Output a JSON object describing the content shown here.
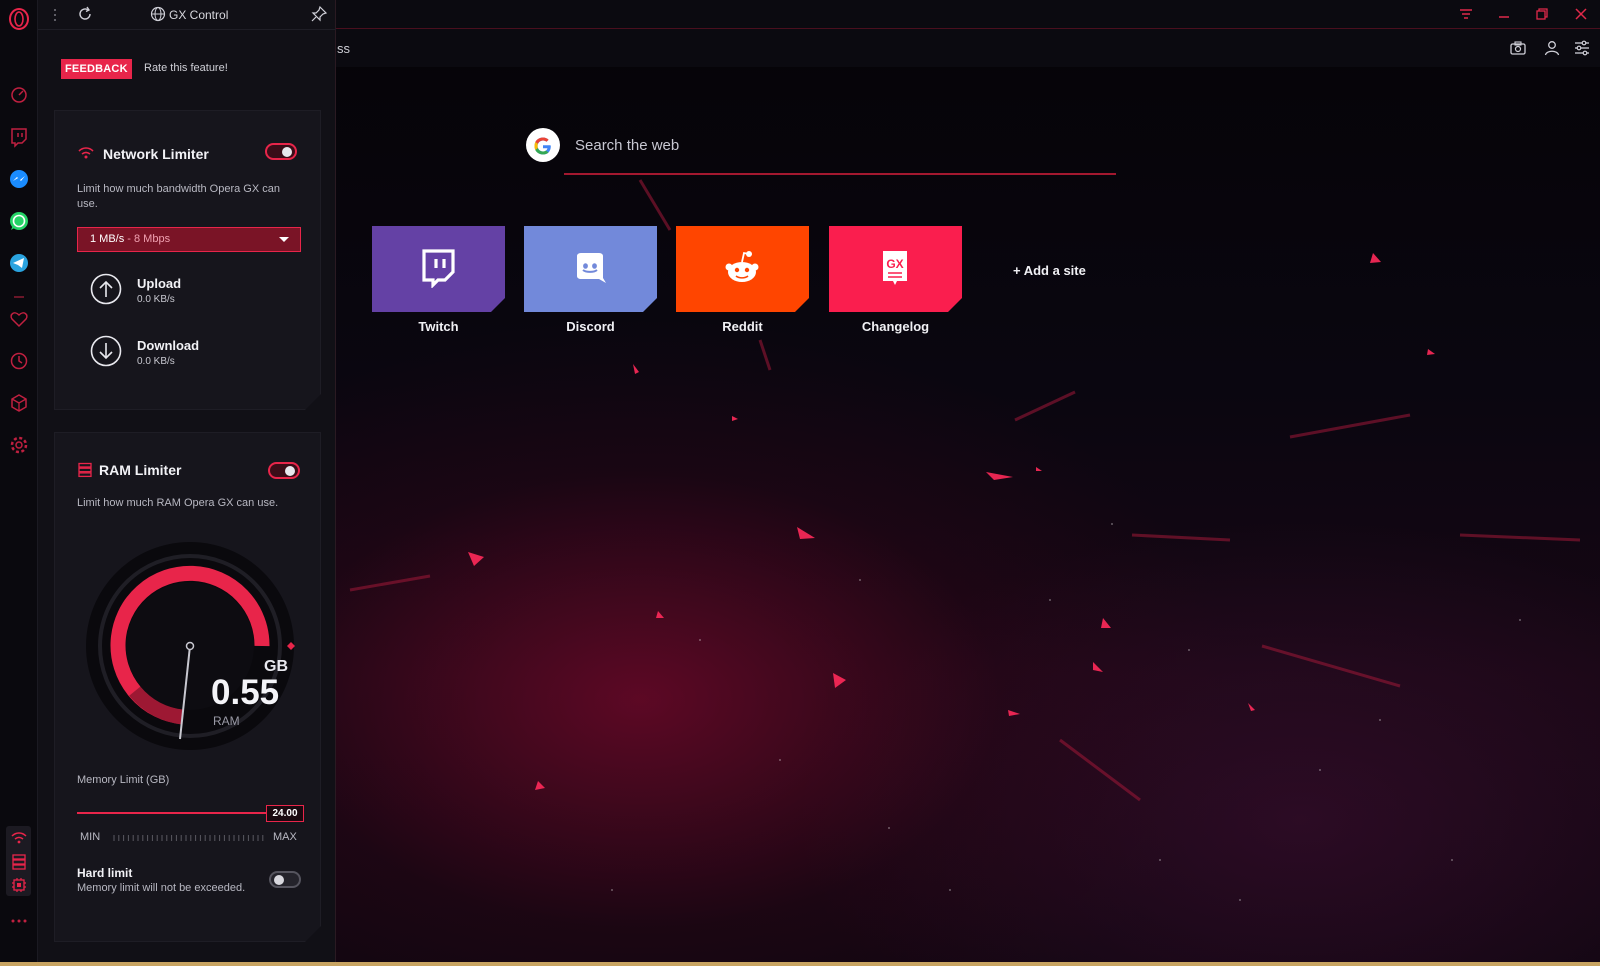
{
  "window": {
    "controls": [
      "filter-icon",
      "minimize-icon",
      "restore-icon",
      "close-icon"
    ],
    "address_fragment": "ss"
  },
  "colors": {
    "accent": "#e8254a",
    "panel_bg": "#111016",
    "card_bg": "#16151c",
    "twitch": "#6441a5",
    "discord": "#7289da",
    "reddit": "#ff4500",
    "changelog": "#fa1e4e"
  },
  "rail": {
    "items": [
      "opera-logo-icon",
      "speed-dial-icon",
      "twitch-icon",
      "messenger-icon",
      "whatsapp-icon",
      "telegram-icon",
      "favorites-icon",
      "history-icon",
      "extensions-icon",
      "settings-icon",
      "network-limiter-icon",
      "ram-limiter-icon",
      "cpu-limiter-icon",
      "more-icon"
    ]
  },
  "panel": {
    "title": "GX Control",
    "feedback_label": "FEEDBACK",
    "rate_text": "Rate this feature!",
    "network": {
      "title": "Network Limiter",
      "enabled": true,
      "description": "Limit how much bandwidth Opera GX can use.",
      "selected_main": "1 MB/s",
      "selected_sub": " - 8 Mbps",
      "upload_label": "Upload",
      "upload_value": "0.0 KB/s",
      "download_label": "Download",
      "download_value": "0.0 KB/s"
    },
    "ram": {
      "title": "RAM Limiter",
      "enabled": true,
      "description": "Limit how much RAM Opera GX can use.",
      "gauge_value": "0.55",
      "gauge_unit": "GB",
      "gauge_label": "RAM",
      "gauge_fraction": 0.023,
      "memory_limit_label": "Memory Limit (GB)",
      "slider_value": "24.00",
      "slider_fraction": 1.0,
      "min_label": "MIN",
      "max_label": "MAX",
      "hard_limit_title": "Hard limit",
      "hard_limit_desc": "Memory limit will not be exceeded.",
      "hard_limit_enabled": false
    }
  },
  "main": {
    "search_placeholder": "Search the web",
    "tiles": [
      {
        "label": "Twitch",
        "icon": "twitch-logo-icon"
      },
      {
        "label": "Discord",
        "icon": "discord-logo-icon"
      },
      {
        "label": "Reddit",
        "icon": "reddit-logo-icon"
      },
      {
        "label": "Changelog",
        "icon": "gx-changelog-icon"
      }
    ],
    "add_site_label": "+ Add a site"
  }
}
